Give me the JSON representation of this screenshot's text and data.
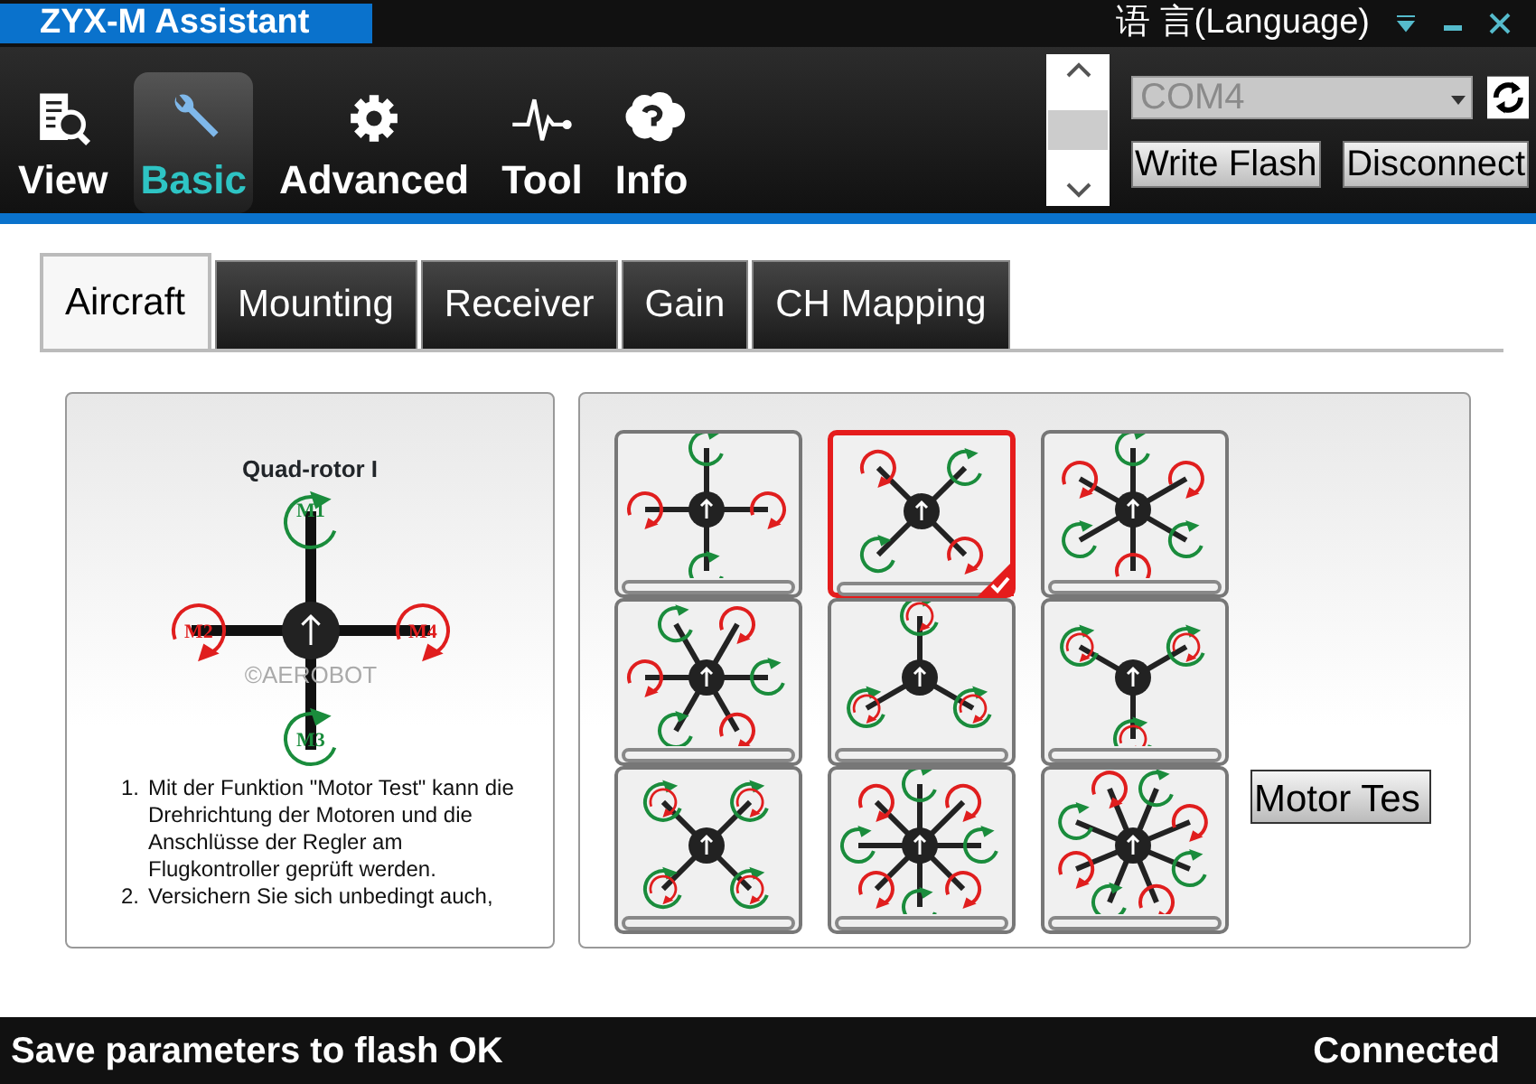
{
  "window": {
    "title": "ZYX-M Assistant",
    "language": "语 言(Language)"
  },
  "nav": [
    {
      "label": "View",
      "selected": false
    },
    {
      "label": "Basic",
      "selected": true
    },
    {
      "label": "Advanced",
      "selected": false
    },
    {
      "label": "Tool",
      "selected": false
    },
    {
      "label": "Info",
      "selected": false
    }
  ],
  "port": {
    "value": "COM4"
  },
  "buttons": [
    "Write Flash",
    "Disconnect"
  ],
  "tabs": [
    {
      "label": "Aircraft",
      "selected": true
    },
    {
      "label": "Mounting",
      "selected": false
    },
    {
      "label": "Receiver",
      "selected": false
    },
    {
      "label": "Gain",
      "selected": false
    },
    {
      "label": "CH Mapping",
      "selected": false
    }
  ],
  "aircraft": {
    "title": "Quad-rotor I",
    "motors": [
      "M1",
      "M2",
      "M3",
      "M4"
    ],
    "image_mark": "©AEROBOT",
    "instructions": [
      {
        "marker": "1.",
        "text": "Mit der Funktion \"Motor Test\" kann die Drehrichtung der Motoren und die Anschlüsse der Regler am Flugkontroller geprüft werden."
      },
      {
        "marker": "2.",
        "text": "Versichern Sie sich unbedingt auch,"
      }
    ]
  },
  "frames": [
    {
      "kind": "quad-plus",
      "selected": false
    },
    {
      "kind": "quad-x",
      "selected": true
    },
    {
      "kind": "hexa-i",
      "selected": false
    },
    {
      "kind": "hexa-v",
      "selected": false
    },
    {
      "kind": "tri-y",
      "selected": false
    },
    {
      "kind": "tri-iy",
      "selected": false
    },
    {
      "kind": "x8",
      "selected": false
    },
    {
      "kind": "octo-i",
      "selected": false
    },
    {
      "kind": "octo-v",
      "selected": false
    }
  ],
  "motor_test_button": "Motor Tes",
  "status_bar": {
    "message": "Save parameters to flash OK",
    "connection": "Connected"
  }
}
